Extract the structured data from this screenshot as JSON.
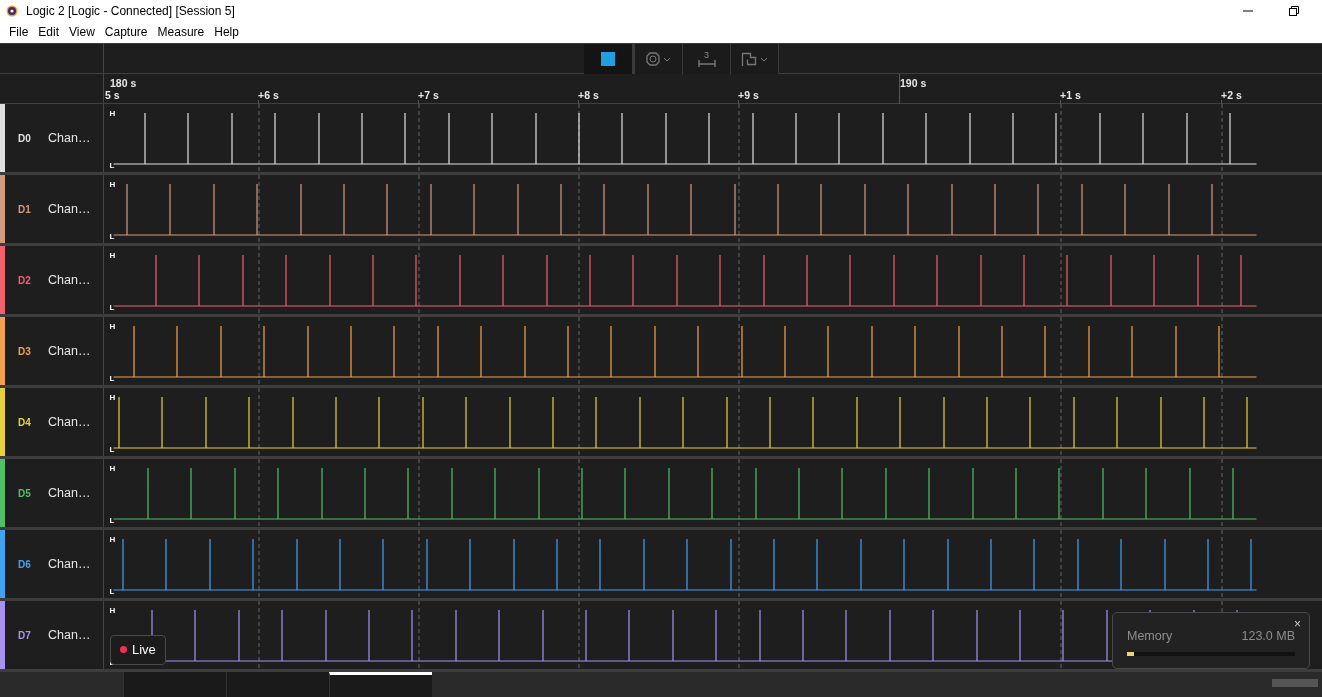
{
  "window": {
    "title": "Logic 2 [Logic - Connected] [Session 5]"
  },
  "menu": [
    "File",
    "Edit",
    "View",
    "Capture",
    "Measure",
    "Help"
  ],
  "toolbar": {
    "marker_count": "3"
  },
  "timeline": {
    "major": [
      "180 s",
      "190 s"
    ],
    "minor": [
      "5 s",
      "+6 s",
      "+7 s",
      "+8 s",
      "+9 s",
      "+1 s",
      "+2 s"
    ]
  },
  "channels": [
    {
      "id": "D0",
      "name": "Chan…",
      "color": "#e0e0e0",
      "high_label": "H",
      "low_label": "L"
    },
    {
      "id": "D1",
      "name": "Chan…",
      "color": "#d29a7e",
      "high_label": "H",
      "low_label": "L"
    },
    {
      "id": "D2",
      "name": "Chan…",
      "color": "#f2606c",
      "high_label": "H",
      "low_label": "L"
    },
    {
      "id": "D3",
      "name": "Chan…",
      "color": "#f2a24e",
      "high_label": "H",
      "low_label": "L"
    },
    {
      "id": "D4",
      "name": "Chan…",
      "color": "#e6d23c",
      "high_label": "H",
      "low_label": "L"
    },
    {
      "id": "D5",
      "name": "Chan…",
      "color": "#52c066",
      "high_label": "H",
      "low_label": "L"
    },
    {
      "id": "D6",
      "name": "Chan…",
      "color": "#42a2f2",
      "high_label": "H",
      "low_label": "L"
    },
    {
      "id": "D7",
      "name": "Chan…",
      "color": "#a892f0",
      "high_label": "H",
      "low_label": "L"
    }
  ],
  "live_badge": {
    "label": "Live"
  },
  "memory": {
    "label": "Memory",
    "reading": "123.0 MB",
    "level": 0.04,
    "close": "×"
  },
  "bottom_tabs": [
    {
      "selected": false
    },
    {
      "selected": false
    },
    {
      "selected": true
    }
  ]
}
